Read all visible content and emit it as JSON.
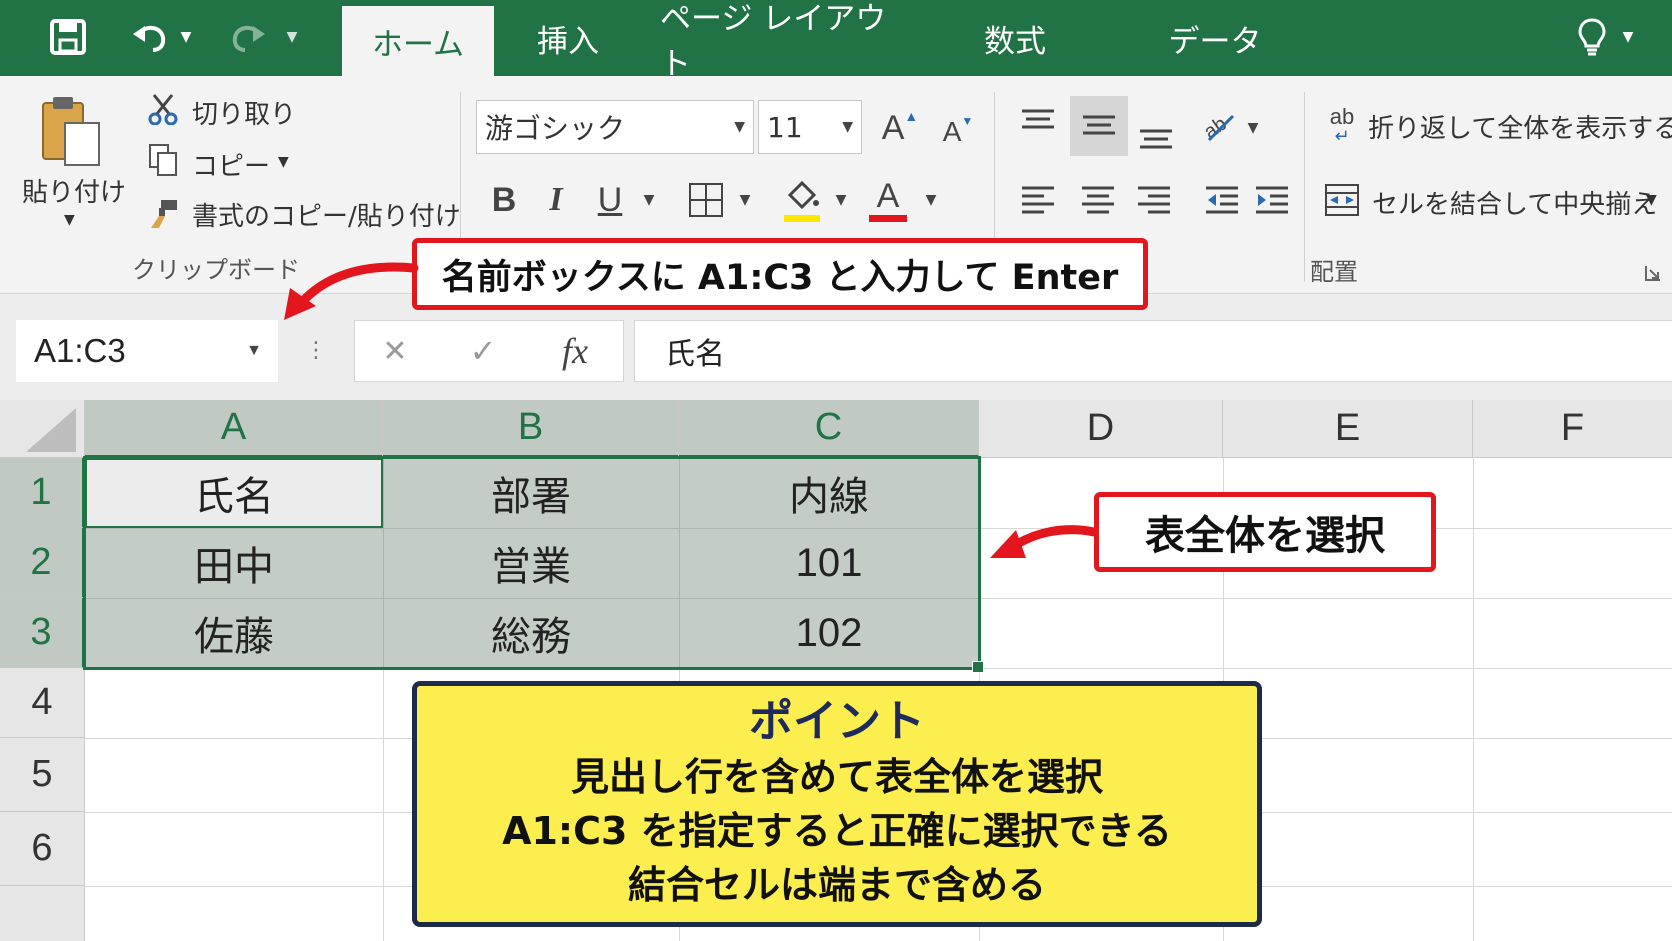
{
  "qat": {
    "save_icon": "save-icon",
    "undo_icon": "undo-icon",
    "redo_icon": "redo-icon"
  },
  "tabs": [
    {
      "label": "ホーム",
      "active": true
    },
    {
      "label": "挿入"
    },
    {
      "label": "ページ レイアウト"
    },
    {
      "label": "数式"
    },
    {
      "label": "データ"
    }
  ],
  "clipboard": {
    "paste_label": "貼り付け",
    "cut_label": "切り取り",
    "copy_label": "コピー",
    "format_painter_label": "書式のコピー/貼り付け",
    "group_label": "クリップボード"
  },
  "font": {
    "name": "游ゴシック",
    "size": "11",
    "bold": "B",
    "italic": "I",
    "underline": "U",
    "font_color_letter": "A",
    "grow_letter": "A",
    "shrink_letter": "A",
    "highlight_color": "#ffe600",
    "font_color": "#e3161d"
  },
  "alignment": {
    "wrap_text_label": "折り返して全体を表示する",
    "merge_center_label": "セルを結合して中央揃え",
    "group_label": "配置",
    "wrap_glyph": "ab"
  },
  "formula_bar": {
    "name_box_value": "A1:C3",
    "cancel_symbol": "✕",
    "enter_symbol": "✓",
    "fx_label": "fx",
    "formula_value": "氏名"
  },
  "columns": [
    "A",
    "B",
    "C",
    "D",
    "E",
    "F"
  ],
  "rows": [
    "1",
    "2",
    "3",
    "4",
    "5",
    "6"
  ],
  "cells": [
    [
      "氏名",
      "部署",
      "内線"
    ],
    [
      "田中",
      "営業",
      "101"
    ],
    [
      "佐藤",
      "総務",
      "102"
    ]
  ],
  "callouts": {
    "name_box_tip": "名前ボックスに A1:C3 と入力して Enter",
    "select_table_tip": "表全体を選択"
  },
  "point": {
    "title": "ポイント",
    "lines": [
      "見出し行を含めて表全体を選択",
      "A1:C3 を指定すると正確に選択できる",
      "結合セルは端まで含める"
    ]
  },
  "colors": {
    "excel_green": "#217346",
    "callout_red": "#e3161d",
    "point_yellow": "#fdee4f",
    "point_border": "#1d2a4a"
  }
}
